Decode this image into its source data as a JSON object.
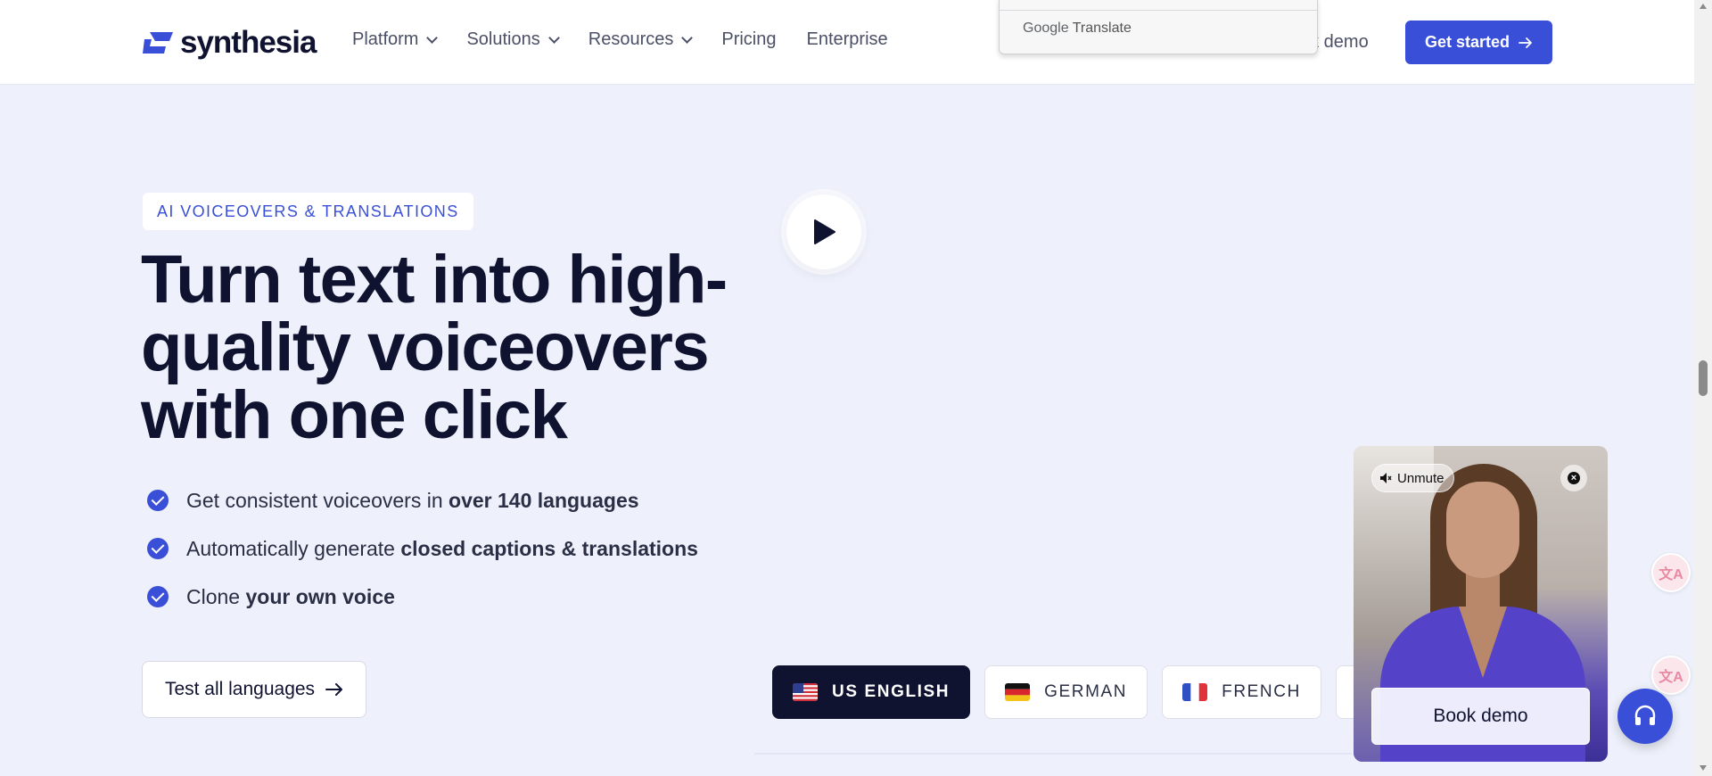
{
  "header": {
    "logo_text": "synthesia",
    "nav": [
      {
        "label": "Platform",
        "has_dropdown": true
      },
      {
        "label": "Solutions",
        "has_dropdown": true
      },
      {
        "label": "Resources",
        "has_dropdown": true
      },
      {
        "label": "Pricing",
        "has_dropdown": false
      },
      {
        "label": "Enterprise",
        "has_dropdown": false
      }
    ],
    "book_demo_label": "ok demo",
    "get_started_label": "Get started"
  },
  "google_translate": {
    "brand": "Google",
    "label": "Translate"
  },
  "hero": {
    "tag": "AI VOICEOVERS & TRANSLATIONS",
    "headline": "Turn text into high-quality voiceovers with one click",
    "bullets": [
      {
        "text": "Get consistent voiceovers in ",
        "bold": "over 140 languages"
      },
      {
        "text": "Automatically generate ",
        "bold": "closed captions & translations"
      },
      {
        "text": "Clone ",
        "bold": "your own voice"
      }
    ],
    "cta_label": "Test all languages"
  },
  "languages": [
    {
      "label": "US ENGLISH",
      "active": true,
      "flag": "us-flag"
    },
    {
      "label": "GERMAN",
      "active": false,
      "flag": "de-flag"
    },
    {
      "label": "FRENCH",
      "active": false,
      "flag": "fr-flag"
    },
    {
      "label": "",
      "active": false,
      "flag": "es-flag"
    }
  ],
  "video_widget": {
    "unmute_label": "Unmute",
    "book_demo_label": "Book demo"
  },
  "colors": {
    "accent": "#3a4fd8",
    "background": "#eef1fb",
    "text_dark": "#0f1330"
  }
}
